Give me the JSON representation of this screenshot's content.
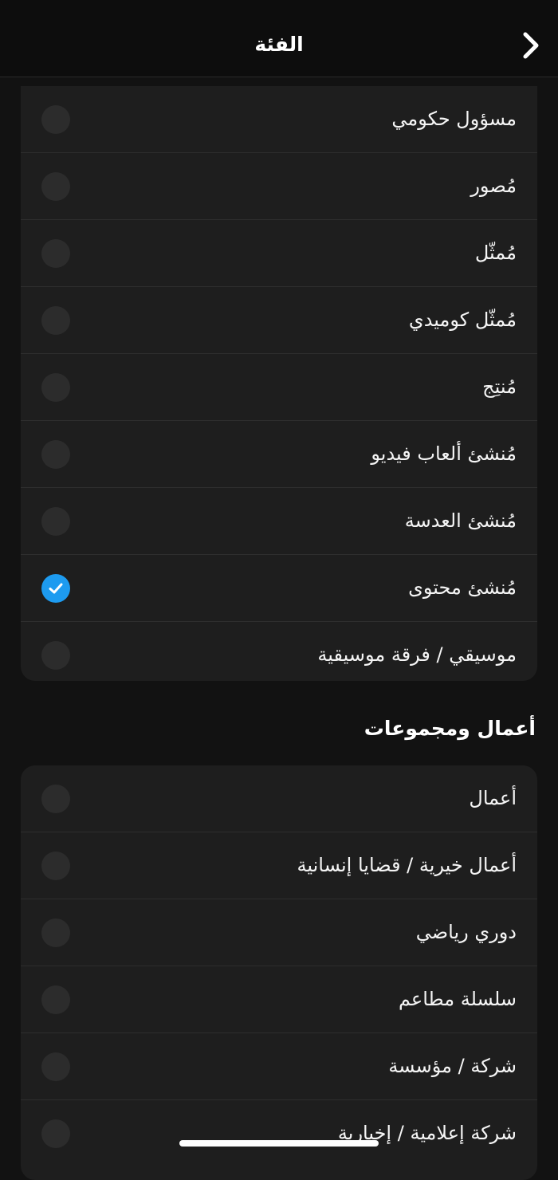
{
  "header": {
    "title": "الفئة"
  },
  "section1": {
    "items": [
      {
        "label": "مسؤول حكومي",
        "selected": false
      },
      {
        "label": "مُصور",
        "selected": false
      },
      {
        "label": "مُمثّل",
        "selected": false
      },
      {
        "label": "مُمثّل كوميدي",
        "selected": false
      },
      {
        "label": "مُنتِج",
        "selected": false
      },
      {
        "label": "مُنشئ ألعاب فيديو",
        "selected": false
      },
      {
        "label": "مُنشئ العدسة",
        "selected": false
      },
      {
        "label": "مُنشئ محتوى",
        "selected": true
      },
      {
        "label": "موسيقي / فرقة موسيقية",
        "selected": false
      }
    ]
  },
  "section2": {
    "heading": "أعمال ومجموعات",
    "items": [
      {
        "label": "أعمال",
        "selected": false
      },
      {
        "label": "أعمال خيرية / قضايا إنسانية",
        "selected": false
      },
      {
        "label": "دوري رياضي",
        "selected": false
      },
      {
        "label": "سلسلة مطاعم",
        "selected": false
      },
      {
        "label": "شركة / مؤسسة",
        "selected": false
      },
      {
        "label": "شركة إعلامية / إخبارية",
        "selected": false
      }
    ]
  },
  "colors": {
    "background": "#121212",
    "card": "#1e1e1e",
    "accent": "#1d9bf0",
    "radio_unselected": "#2c2c2c"
  },
  "icons": {
    "back": "chevron-right-icon",
    "check": "checkmark-icon"
  }
}
